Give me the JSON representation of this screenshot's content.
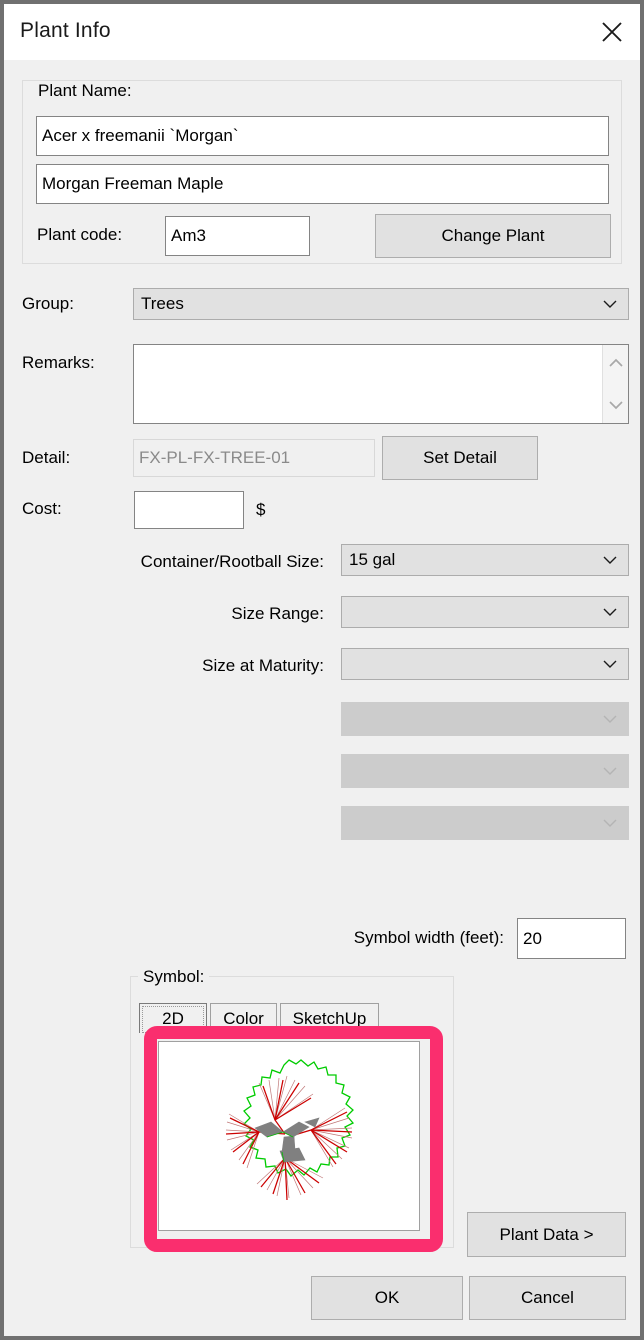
{
  "window": {
    "title": "Plant Info",
    "close_icon": "close-icon",
    "border_color": "#707070",
    "bg_color": "#f0f0f0"
  },
  "plant_name_group": {
    "legend": "Plant Name:",
    "botanical_name": "Acer x freemanii `Morgan`",
    "common_name": "Morgan Freeman Maple",
    "plant_code_label": "Plant code:",
    "plant_code": "Am3",
    "change_plant_button": "Change Plant"
  },
  "fields": {
    "group_label": "Group:",
    "group_value": "Trees",
    "remarks_label": "Remarks:",
    "remarks_value": "",
    "detail_label": "Detail:",
    "detail_value": "FX-PL-FX-TREE-01",
    "set_detail_button": "Set Detail",
    "cost_label": "Cost:",
    "cost_value": "",
    "currency_symbol": "$",
    "container_label": "Container/Rootball Size:",
    "container_value": "15 gal",
    "size_range_label": "Size Range:",
    "size_range_value": "",
    "size_maturity_label": "Size at Maturity:",
    "size_maturity_value": "",
    "extra_combo_1": "",
    "extra_combo_2": "",
    "extra_combo_3": ""
  },
  "symbol": {
    "width_label": "Symbol width (feet):",
    "width_value": "20",
    "legend": "Symbol:",
    "tabs": [
      {
        "label": "2D",
        "selected": true
      },
      {
        "label": "Color",
        "selected": false
      },
      {
        "label": "SketchUp",
        "selected": false
      }
    ],
    "preview_alt": "plan-view-tree-symbol",
    "highlight_color": "#fa2e6e",
    "canopy_color": "#00cc00",
    "branch_color": "#cc0000",
    "trunk_color": "#808080"
  },
  "footer": {
    "plant_data_button": "Plant Data >",
    "ok_button": "OK",
    "cancel_button": "Cancel"
  }
}
